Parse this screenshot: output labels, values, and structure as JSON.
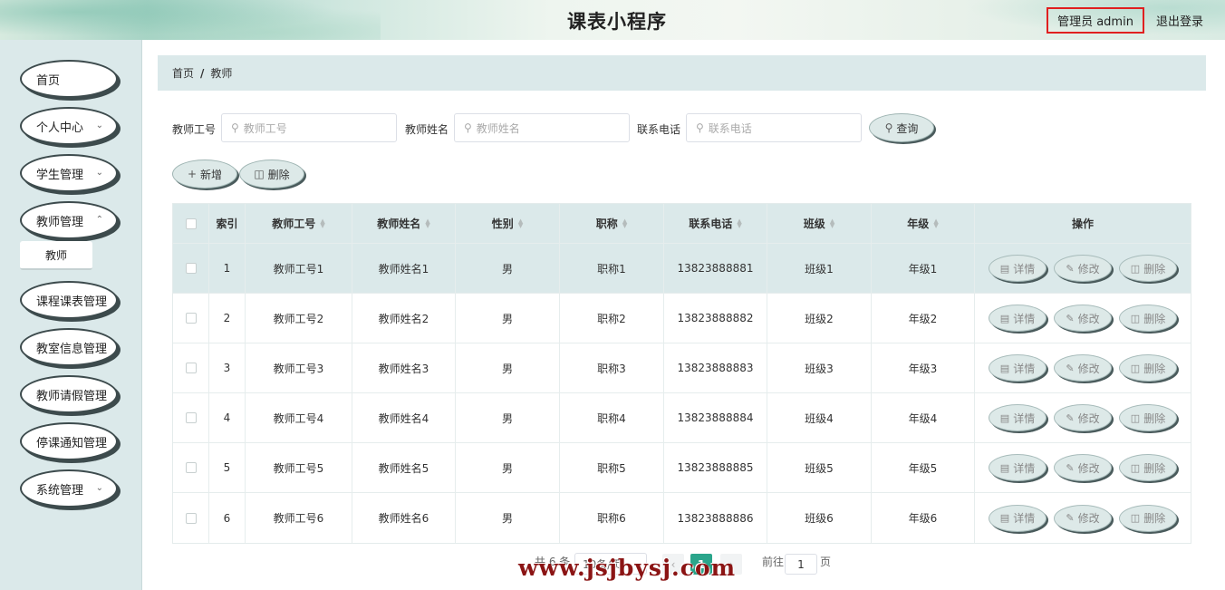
{
  "header": {
    "title": "课表小程序",
    "user_label": "管理员 admin",
    "logout_label": "退出登录"
  },
  "sidebar": {
    "items": [
      {
        "label": "首页",
        "has_arrow": false
      },
      {
        "label": "个人中心",
        "has_arrow": true
      },
      {
        "label": "学生管理",
        "has_arrow": true
      },
      {
        "label": "教师管理",
        "has_arrow": true
      },
      {
        "label": "课程课表管理",
        "has_arrow": true
      },
      {
        "label": "教室信息管理",
        "has_arrow": true
      },
      {
        "label": "教师请假管理",
        "has_arrow": true
      },
      {
        "label": "停课通知管理",
        "has_arrow": true
      },
      {
        "label": "系统管理",
        "has_arrow": true
      }
    ],
    "submenu": {
      "label": "教师"
    }
  },
  "breadcrumb": {
    "home": "首页",
    "separator": "/",
    "current": "教师"
  },
  "search": {
    "fields": [
      {
        "label": "教师工号",
        "placeholder": "教师工号"
      },
      {
        "label": "教师姓名",
        "placeholder": "教师姓名"
      },
      {
        "label": "联系电话",
        "placeholder": "联系电话"
      }
    ],
    "query_label": "查询"
  },
  "actions": {
    "add_label": "新增",
    "delete_label": "删除"
  },
  "table": {
    "columns": [
      "索引",
      "教师工号",
      "教师姓名",
      "性别",
      "职称",
      "联系电话",
      "班级",
      "年级",
      "操作"
    ],
    "rows": [
      {
        "index": "1",
        "teacher_id": "教师工号1",
        "name": "教师姓名1",
        "gender": "男",
        "title": "职称1",
        "phone": "13823888881",
        "class": "班级1",
        "grade": "年级1"
      },
      {
        "index": "2",
        "teacher_id": "教师工号2",
        "name": "教师姓名2",
        "gender": "男",
        "title": "职称2",
        "phone": "13823888882",
        "class": "班级2",
        "grade": "年级2"
      },
      {
        "index": "3",
        "teacher_id": "教师工号3",
        "name": "教师姓名3",
        "gender": "男",
        "title": "职称3",
        "phone": "13823888883",
        "class": "班级3",
        "grade": "年级3"
      },
      {
        "index": "4",
        "teacher_id": "教师工号4",
        "name": "教师姓名4",
        "gender": "男",
        "title": "职称4",
        "phone": "13823888884",
        "class": "班级4",
        "grade": "年级4"
      },
      {
        "index": "5",
        "teacher_id": "教师工号5",
        "name": "教师姓名5",
        "gender": "男",
        "title": "职称5",
        "phone": "13823888885",
        "class": "班级5",
        "grade": "年级5"
      },
      {
        "index": "6",
        "teacher_id": "教师工号6",
        "name": "教师姓名6",
        "gender": "男",
        "title": "职称6",
        "phone": "13823888886",
        "class": "班级6",
        "grade": "年级6"
      }
    ],
    "row_actions": {
      "detail": "详情",
      "edit": "修改",
      "delete": "删除"
    }
  },
  "pagination": {
    "total_text": "共 6 条",
    "page_size_text": "10条/页",
    "current_page": "1",
    "goto_prefix": "前往",
    "goto_value": "1",
    "goto_suffix": "页"
  },
  "watermark": "www.jsjbysj.com",
  "colors": {
    "sidebar_bg": "#dbe9ea",
    "accent": "#2aa58b",
    "highlight_border": "#e02020",
    "watermark": "#8b1414"
  }
}
